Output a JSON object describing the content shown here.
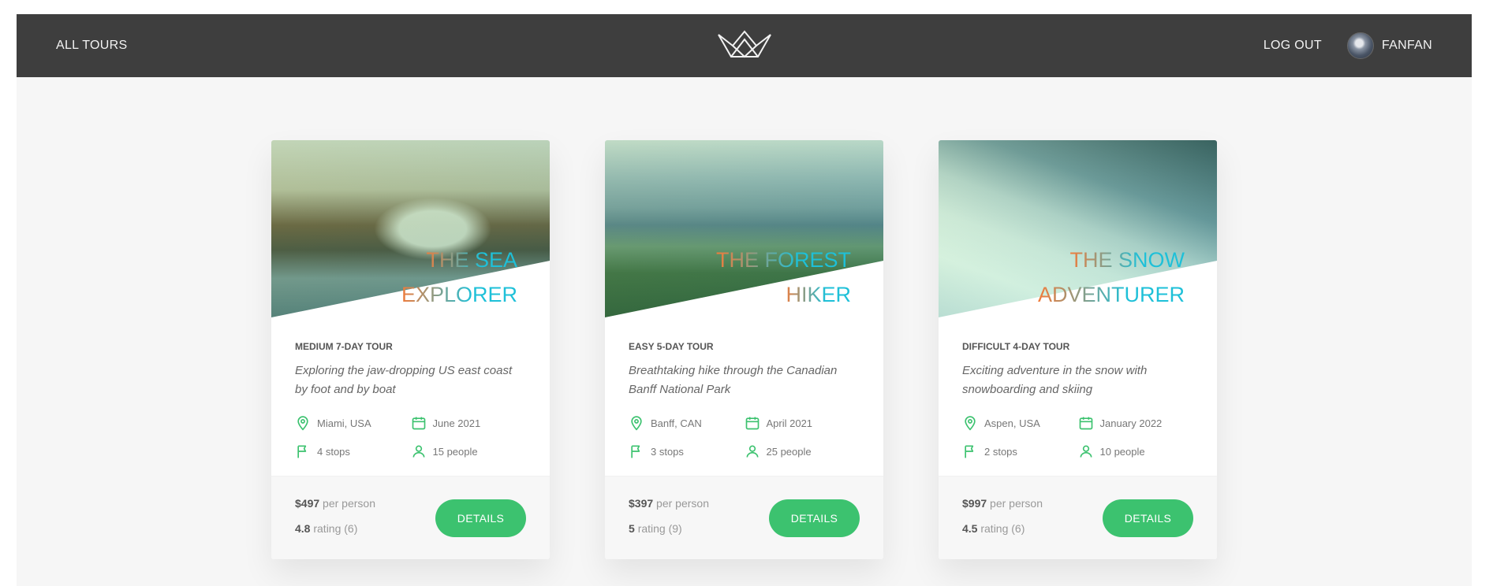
{
  "header": {
    "nav_left": "ALL TOURS",
    "logout": "LOG OUT",
    "user_name": "FANFAN"
  },
  "colors": {
    "header_bg": "#3e3e3e",
    "page_bg": "#f6f6f6",
    "accent_green": "#3cc26f",
    "title_gradient_start": "#ff7730",
    "title_gradient_end": "#1ec0d8"
  },
  "icons": {
    "location": "map-pin-icon",
    "date": "calendar-icon",
    "stops": "flag-icon",
    "people": "user-icon",
    "logo": "crown-logo-icon"
  },
  "tours": [
    {
      "title_line1": "THE SEA",
      "title_line2": "EXPLORER",
      "sub_heading": "MEDIUM 7-DAY TOUR",
      "summary": "Exploring the jaw-dropping US east coast by foot and by boat",
      "location": "Miami, USA",
      "date": "June 2021",
      "stops": "4 stops",
      "people": "15 people",
      "price": "$497",
      "price_suffix": "per person",
      "rating": "4.8",
      "rating_suffix": "rating (6)",
      "button": "DETAILS"
    },
    {
      "title_line1": "THE FOREST",
      "title_line2": "HIKER",
      "sub_heading": "EASY 5-DAY TOUR",
      "summary": "Breathtaking hike through the Canadian Banff National Park",
      "location": "Banff, CAN",
      "date": "April 2021",
      "stops": "3 stops",
      "people": "25 people",
      "price": "$397",
      "price_suffix": "per person",
      "rating": "5",
      "rating_suffix": "rating (9)",
      "button": "DETAILS"
    },
    {
      "title_line1": "THE SNOW",
      "title_line2": "ADVENTURER",
      "sub_heading": "DIFFICULT 4-DAY TOUR",
      "summary": "Exciting adventure in the snow with snowboarding and skiing",
      "location": "Aspen, USA",
      "date": "January 2022",
      "stops": "2 stops",
      "people": "10 people",
      "price": "$997",
      "price_suffix": "per person",
      "rating": "4.5",
      "rating_suffix": "rating (6)",
      "button": "DETAILS"
    }
  ]
}
